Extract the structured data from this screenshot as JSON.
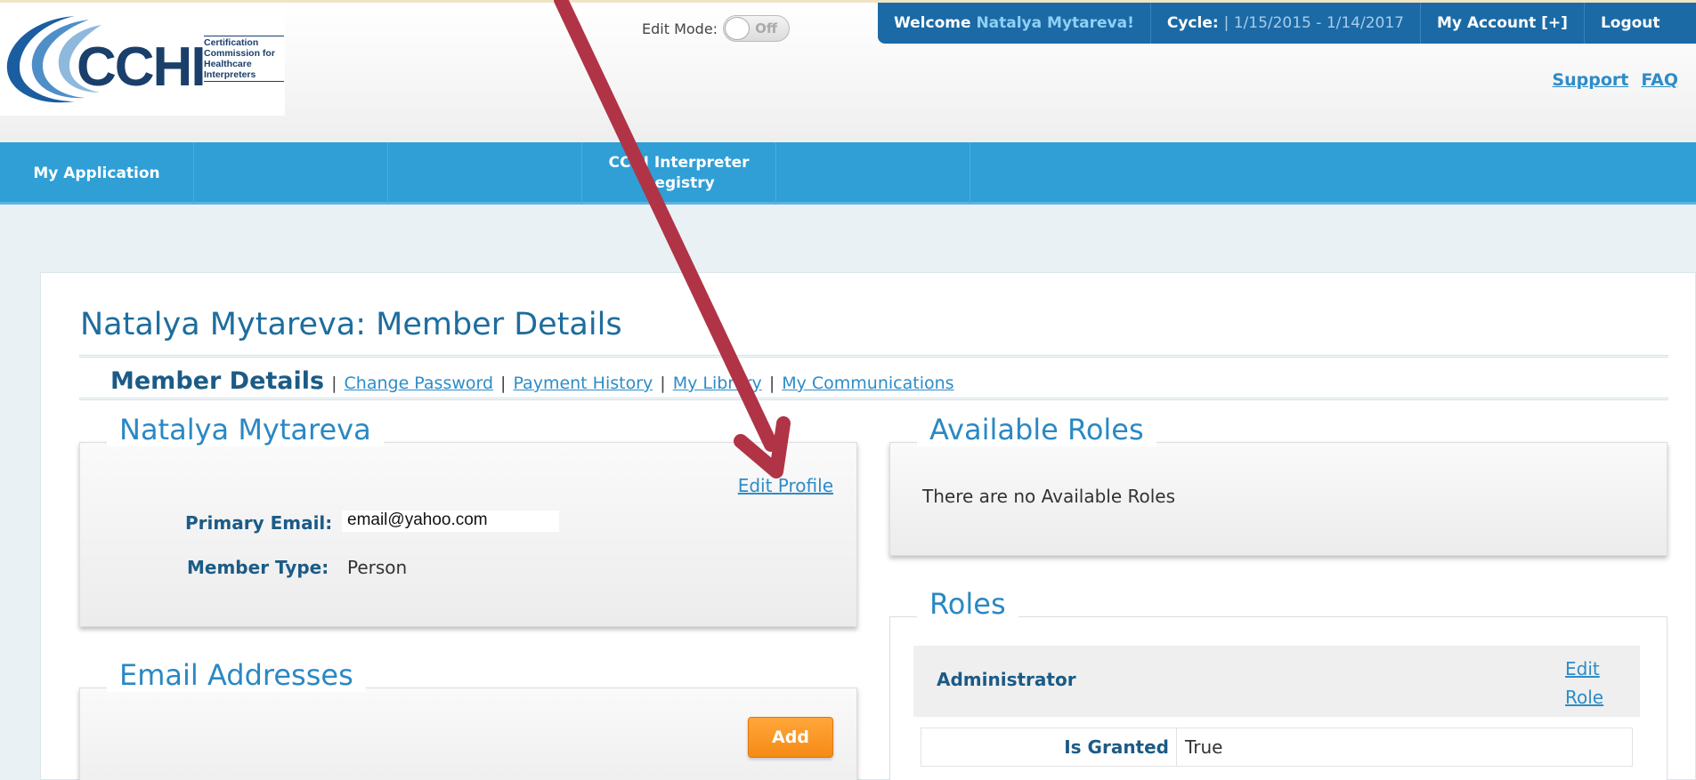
{
  "header": {
    "logo_text": [
      "Certification",
      "Commission for",
      "Healthcare",
      "Interpreters"
    ],
    "edit_mode_label": "Edit Mode:",
    "edit_mode_state": "Off",
    "welcome_prefix": "Welcome",
    "welcome_name": "Natalya Mytareva!",
    "cycle_label": "Cycle:",
    "cycle_value": "| 1/15/2015 - 1/14/2017",
    "my_account": "My Account [+]",
    "logout": "Logout",
    "support": "Support",
    "faq": "FAQ"
  },
  "nav": {
    "items": [
      "My Application",
      "",
      "",
      "CCHI Interpreter Registry",
      ""
    ]
  },
  "page": {
    "title": "Natalya Mytareva: Member Details",
    "subnav": {
      "current": "Member Details",
      "links": [
        "Change Password",
        "Payment History",
        "My Library",
        "My Communications"
      ],
      "separator": "|"
    },
    "profile_panel": {
      "title": "Natalya Mytareva",
      "edit_profile": "Edit Profile",
      "primary_email_label": "Primary Email:",
      "primary_email_value": "email@yahoo.com",
      "member_type_label": "Member Type:",
      "member_type_value": "Person"
    },
    "email_panel": {
      "title": "Email Addresses",
      "add_button": "Add"
    },
    "available_roles_panel": {
      "title": "Available Roles",
      "empty_message": "There are no Available Roles"
    },
    "roles_panel": {
      "title": "Roles",
      "role_name": "Administrator",
      "edit_role_line1": "Edit",
      "edit_role_line2": "Role",
      "granted_label": "Is Granted",
      "granted_value": "True"
    }
  },
  "colors": {
    "topbar": "#1b6aa6",
    "nav": "#2f9fd6",
    "link": "#2d8cc8",
    "heading": "#1e6d9e",
    "add_button": "#f68a16",
    "annotation_arrow": "#b03446"
  },
  "icons": [
    "cchi-logo",
    "toggle-switch",
    "annotation-arrow"
  ]
}
